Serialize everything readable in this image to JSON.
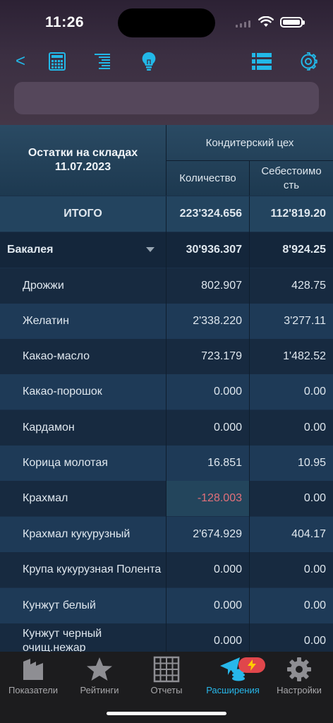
{
  "status_bar": {
    "time": "11:26"
  },
  "toolbar": {
    "back_label": "<",
    "icons": [
      "calculator-icon",
      "align-lines-icon",
      "lightbulb-icon",
      "list-icon",
      "gear-icon"
    ],
    "accent_color": "#22b8e8"
  },
  "table": {
    "header": {
      "title_line1": "Остатки на складах",
      "title_line2": "11.07.2023",
      "shop": "Кондитерский цех",
      "qty_label": "Количество",
      "cost_label": "Себестоимо сть"
    },
    "total": {
      "label": "ИТОГО",
      "qty": "223'324.656",
      "cost": "112'819.20"
    },
    "group": {
      "label": "Бакалея",
      "qty": "30'936.307",
      "cost": "8'924.25"
    },
    "rows": [
      {
        "name": "Дрожжи",
        "qty": "802.907",
        "cost": "428.75"
      },
      {
        "name": "Желатин",
        "qty": "2'338.220",
        "cost": "3'277.11"
      },
      {
        "name": "Какао-масло",
        "qty": "723.179",
        "cost": "1'482.52"
      },
      {
        "name": "Какао-порошок",
        "qty": "0.000",
        "cost": "0.00"
      },
      {
        "name": "Кардамон",
        "qty": "0.000",
        "cost": "0.00"
      },
      {
        "name": "Корица молотая",
        "qty": "16.851",
        "cost": "10.95"
      },
      {
        "name": "Крахмал",
        "qty": "-128.003",
        "cost": "0.00"
      },
      {
        "name": "Крахмал кукурузный",
        "qty": "2'674.929",
        "cost": "404.17"
      },
      {
        "name": "Крупа кукурузная Полента",
        "qty": "0.000",
        "cost": "0.00"
      },
      {
        "name": "Кунжут белый",
        "qty": "0.000",
        "cost": "0.00"
      },
      {
        "name": "Кунжут черный очищ.нежар",
        "qty": "0.000",
        "cost": "0.00"
      }
    ],
    "negative_color": "#e2707a"
  },
  "tabbar": {
    "tabs": [
      {
        "label": "Показатели",
        "icon": "indicators-icon"
      },
      {
        "label": "Рейтинги",
        "icon": "star-icon"
      },
      {
        "label": "Отчеты",
        "icon": "grid-icon"
      },
      {
        "label": "Расширения",
        "icon": "extensions-icon",
        "active": true
      },
      {
        "label": "Настройки",
        "icon": "gear-icon"
      }
    ],
    "active_color": "#27b7ea"
  }
}
